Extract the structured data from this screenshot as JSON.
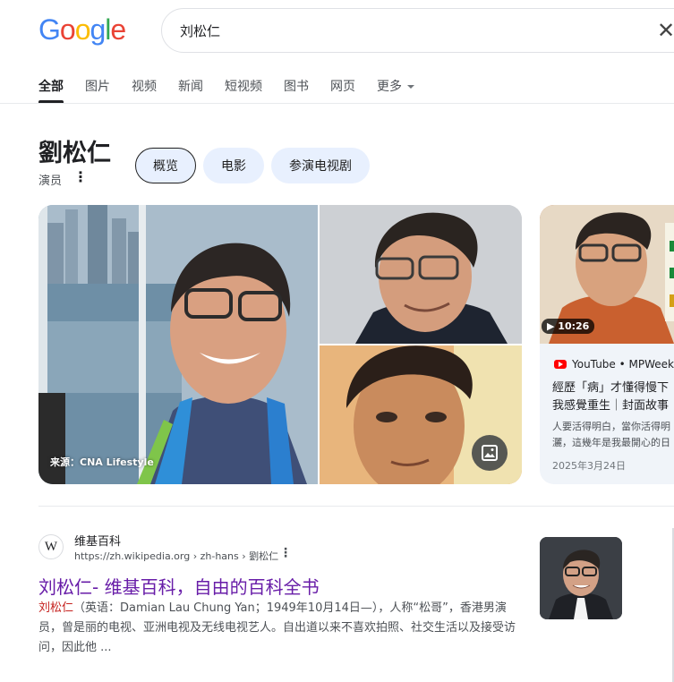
{
  "header": {
    "logo_letters": [
      "G",
      "o",
      "o",
      "g",
      "l",
      "e"
    ],
    "logo_colors": [
      "#4285F4",
      "#EA4335",
      "#FBBC05",
      "#4285F4",
      "#34A853",
      "#EA4335"
    ],
    "search_query": "刘松仁",
    "clear_icon": "close-icon"
  },
  "tabs": [
    {
      "label": "全部",
      "active": true
    },
    {
      "label": "图片"
    },
    {
      "label": "视频"
    },
    {
      "label": "新闻"
    },
    {
      "label": "短视频"
    },
    {
      "label": "图书"
    },
    {
      "label": "网页"
    },
    {
      "label": "更多"
    }
  ],
  "knowledge_panel": {
    "title": "劉松仁",
    "subtitle": "演员",
    "chips": [
      "概览",
      "电影",
      "参演电视剧"
    ],
    "image_source": "来源：CNA Lifestyle"
  },
  "video_card": {
    "duration": "10:26",
    "source": "YouTube • MPWeekly",
    "title": "經歷「病」才懂得慢下\n我感覺重生｜封面故事",
    "description": "人要活得明白，當你活得明\n灑，這幾年是我最開心的日",
    "date": "2025年3月24日"
  },
  "result": {
    "favicon_letter": "W",
    "site_name": "维基百科",
    "url": "https://zh.wikipedia.org › zh-hans › 劉松仁",
    "title": "刘松仁- 维基百科，自由的百科全书",
    "snippet_highlight": "刘松仁",
    "snippet_rest": "（英语：Damian Lau Chung Yan；1949年10月14日—），人称“松哥”，香港男演员，曾是丽的电视、亚洲电视及无线电视艺人。自出道以来不喜欢拍照、社交生活以及接受访问，因此他 ..."
  },
  "colors": {
    "link_visited": "#681da8",
    "chip_bg": "#e8f0fe",
    "highlight": "#c5221f"
  }
}
